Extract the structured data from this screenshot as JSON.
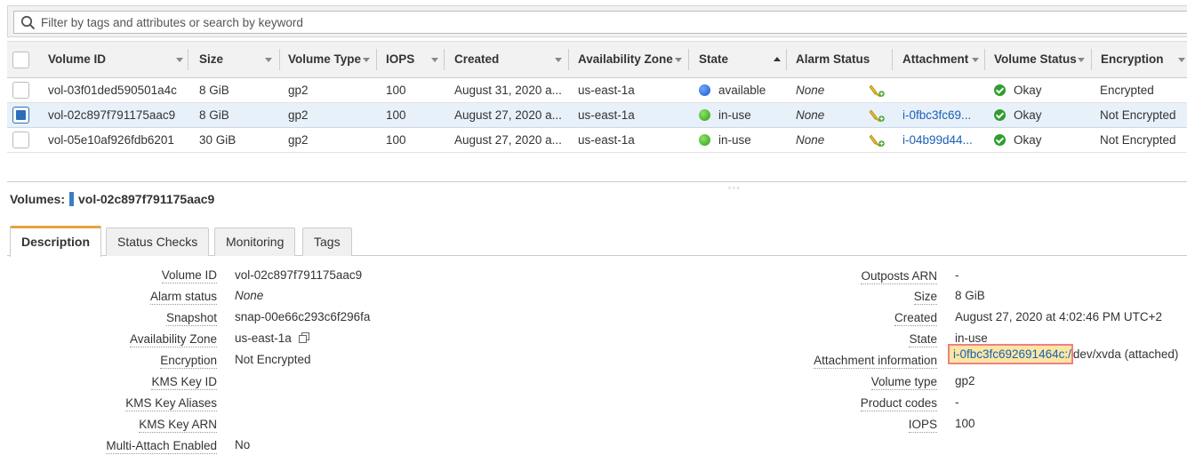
{
  "search": {
    "placeholder": "Filter by tags and attributes or search by keyword"
  },
  "table": {
    "columns": {
      "volume_id": "Volume ID",
      "size": "Size",
      "volume_type": "Volume Type",
      "iops": "IOPS",
      "created": "Created",
      "az": "Availability Zone",
      "state": "State",
      "alarm_status": "Alarm Status",
      "attachment": "Attachment",
      "volume_status": "Volume Status",
      "encryption": "Encryption"
    },
    "rows": [
      {
        "volume_id": "vol-03f01ded590501a4c",
        "size": "8 GiB",
        "type": "gp2",
        "iops": "100",
        "created": "August 31, 2020 a...",
        "az": "us-east-1a",
        "state": "available",
        "alarm": "None",
        "attachment": "",
        "status": "Okay",
        "encryption": "Encrypted"
      },
      {
        "volume_id": "vol-02c897f791175aac9",
        "size": "8 GiB",
        "type": "gp2",
        "iops": "100",
        "created": "August 27, 2020 a...",
        "az": "us-east-1a",
        "state": "in-use",
        "alarm": "None",
        "attachment": "i-0fbc3fc69...",
        "status": "Okay",
        "encryption": "Not Encrypted"
      },
      {
        "volume_id": "vol-05e10af926fdb6201",
        "size": "30 GiB",
        "type": "gp2",
        "iops": "100",
        "created": "August 27, 2020 a...",
        "az": "us-east-1a",
        "state": "in-use",
        "alarm": "None",
        "attachment": "i-04b99d44...",
        "status": "Okay",
        "encryption": "Not Encrypted"
      }
    ],
    "state_colors": {
      "available": "#1a56c9",
      "in-use": "#2d9e12"
    }
  },
  "detail": {
    "title_prefix": "Volumes:",
    "title_value": "vol-02c897f791175aac9",
    "tabs": [
      "Description",
      "Status Checks",
      "Monitoring",
      "Tags"
    ],
    "left": {
      "volume_id": {
        "label": "Volume ID",
        "value": "vol-02c897f791175aac9"
      },
      "alarm_status": {
        "label": "Alarm status",
        "value": "None"
      },
      "snapshot": {
        "label": "Snapshot",
        "value": "snap-00e66c293c6f296fa"
      },
      "az": {
        "label": "Availability Zone",
        "value": "us-east-1a"
      },
      "encryption": {
        "label": "Encryption",
        "value": "Not Encrypted"
      },
      "kms_key_id": {
        "label": "KMS Key ID",
        "value": ""
      },
      "kms_key_aliases": {
        "label": "KMS Key Aliases",
        "value": ""
      },
      "kms_key_arn": {
        "label": "KMS Key ARN",
        "value": ""
      },
      "multi_attach": {
        "label": "Multi-Attach Enabled",
        "value": "No"
      }
    },
    "right": {
      "outposts_arn": {
        "label": "Outposts ARN",
        "value": "-"
      },
      "size": {
        "label": "Size",
        "value": "8 GiB"
      },
      "created": {
        "label": "Created",
        "value": "August 27, 2020 at 4:02:46 PM UTC+2"
      },
      "state": {
        "label": "State",
        "value": "in-use"
      },
      "attachment": {
        "label": "Attachment information",
        "instance": "i-0fbc3fc692691464c:/",
        "rest": "dev/xvda (attached)"
      },
      "volume_type": {
        "label": "Volume type",
        "value": "gp2"
      },
      "product_codes": {
        "label": "Product codes",
        "value": "-"
      },
      "iops": {
        "label": "IOPS",
        "value": "100"
      }
    }
  }
}
